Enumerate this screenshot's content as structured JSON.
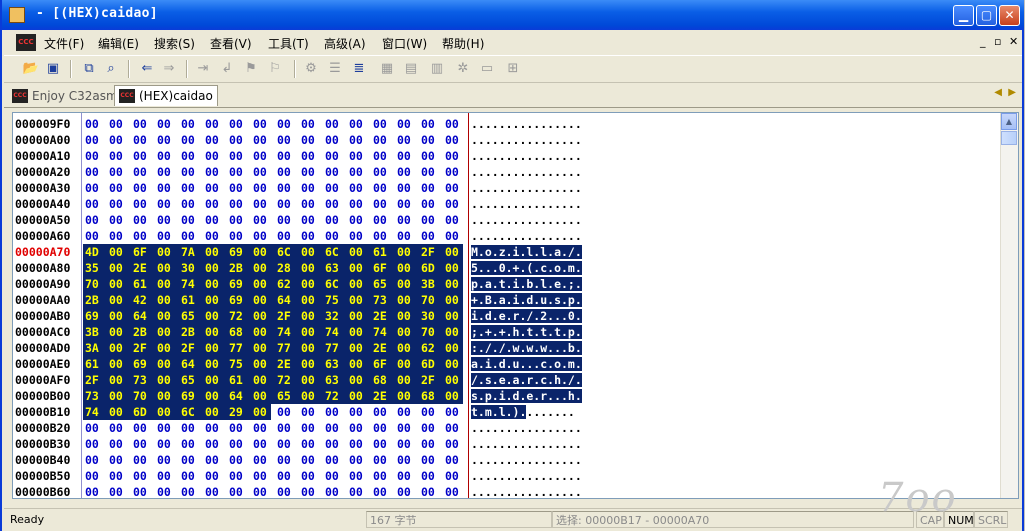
{
  "window": {
    "title": "- [(HEX)caidao]"
  },
  "menu": [
    "文件(F)",
    "编辑(E)",
    "搜索(S)",
    "查看(V)",
    "工具(T)",
    "高级(A)",
    "窗口(W)",
    "帮助(H)"
  ],
  "tabs": [
    {
      "label": "Enjoy C32asm",
      "active": false
    },
    {
      "label": "(HEX)caidao",
      "active": true
    }
  ],
  "hex": {
    "rows": [
      {
        "addr": "000009F0",
        "bytes": [
          "00",
          "00",
          "00",
          "00",
          "00",
          "00",
          "00",
          "00",
          "00",
          "00",
          "00",
          "00",
          "00",
          "00",
          "00",
          "00"
        ],
        "ascii": "................",
        "sel_from": -1,
        "sel_to": -1,
        "addr_highlight": false
      },
      {
        "addr": "00000A00",
        "bytes": [
          "00",
          "00",
          "00",
          "00",
          "00",
          "00",
          "00",
          "00",
          "00",
          "00",
          "00",
          "00",
          "00",
          "00",
          "00",
          "00"
        ],
        "ascii": "................",
        "sel_from": -1,
        "sel_to": -1,
        "addr_highlight": false
      },
      {
        "addr": "00000A10",
        "bytes": [
          "00",
          "00",
          "00",
          "00",
          "00",
          "00",
          "00",
          "00",
          "00",
          "00",
          "00",
          "00",
          "00",
          "00",
          "00",
          "00"
        ],
        "ascii": "................",
        "sel_from": -1,
        "sel_to": -1,
        "addr_highlight": false
      },
      {
        "addr": "00000A20",
        "bytes": [
          "00",
          "00",
          "00",
          "00",
          "00",
          "00",
          "00",
          "00",
          "00",
          "00",
          "00",
          "00",
          "00",
          "00",
          "00",
          "00"
        ],
        "ascii": "................",
        "sel_from": -1,
        "sel_to": -1,
        "addr_highlight": false
      },
      {
        "addr": "00000A30",
        "bytes": [
          "00",
          "00",
          "00",
          "00",
          "00",
          "00",
          "00",
          "00",
          "00",
          "00",
          "00",
          "00",
          "00",
          "00",
          "00",
          "00"
        ],
        "ascii": "................",
        "sel_from": -1,
        "sel_to": -1,
        "addr_highlight": false
      },
      {
        "addr": "00000A40",
        "bytes": [
          "00",
          "00",
          "00",
          "00",
          "00",
          "00",
          "00",
          "00",
          "00",
          "00",
          "00",
          "00",
          "00",
          "00",
          "00",
          "00"
        ],
        "ascii": "................",
        "sel_from": -1,
        "sel_to": -1,
        "addr_highlight": false
      },
      {
        "addr": "00000A50",
        "bytes": [
          "00",
          "00",
          "00",
          "00",
          "00",
          "00",
          "00",
          "00",
          "00",
          "00",
          "00",
          "00",
          "00",
          "00",
          "00",
          "00"
        ],
        "ascii": "................",
        "sel_from": -1,
        "sel_to": -1,
        "addr_highlight": false
      },
      {
        "addr": "00000A60",
        "bytes": [
          "00",
          "00",
          "00",
          "00",
          "00",
          "00",
          "00",
          "00",
          "00",
          "00",
          "00",
          "00",
          "00",
          "00",
          "00",
          "00"
        ],
        "ascii": "................",
        "sel_from": -1,
        "sel_to": -1,
        "addr_highlight": false
      },
      {
        "addr": "00000A70",
        "bytes": [
          "4D",
          "00",
          "6F",
          "00",
          "7A",
          "00",
          "69",
          "00",
          "6C",
          "00",
          "6C",
          "00",
          "61",
          "00",
          "2F",
          "00"
        ],
        "ascii": "M.o.z.i.l.l.a./.",
        "sel_from": 0,
        "sel_to": 15,
        "addr_highlight": true
      },
      {
        "addr": "00000A80",
        "bytes": [
          "35",
          "00",
          "2E",
          "00",
          "30",
          "00",
          "2B",
          "00",
          "28",
          "00",
          "63",
          "00",
          "6F",
          "00",
          "6D",
          "00"
        ],
        "ascii": "5...0.+.(.c.o.m.",
        "sel_from": 0,
        "sel_to": 15,
        "addr_highlight": false
      },
      {
        "addr": "00000A90",
        "bytes": [
          "70",
          "00",
          "61",
          "00",
          "74",
          "00",
          "69",
          "00",
          "62",
          "00",
          "6C",
          "00",
          "65",
          "00",
          "3B",
          "00"
        ],
        "ascii": "p.a.t.i.b.l.e.;.",
        "sel_from": 0,
        "sel_to": 15,
        "addr_highlight": false
      },
      {
        "addr": "00000AA0",
        "bytes": [
          "2B",
          "00",
          "42",
          "00",
          "61",
          "00",
          "69",
          "00",
          "64",
          "00",
          "75",
          "00",
          "73",
          "00",
          "70",
          "00"
        ],
        "ascii": "+.B.a.i.d.u.s.p.",
        "sel_from": 0,
        "sel_to": 15,
        "addr_highlight": false
      },
      {
        "addr": "00000AB0",
        "bytes": [
          "69",
          "00",
          "64",
          "00",
          "65",
          "00",
          "72",
          "00",
          "2F",
          "00",
          "32",
          "00",
          "2E",
          "00",
          "30",
          "00"
        ],
        "ascii": "i.d.e.r./.2...0.",
        "sel_from": 0,
        "sel_to": 15,
        "addr_highlight": false
      },
      {
        "addr": "00000AC0",
        "bytes": [
          "3B",
          "00",
          "2B",
          "00",
          "2B",
          "00",
          "68",
          "00",
          "74",
          "00",
          "74",
          "00",
          "74",
          "00",
          "70",
          "00"
        ],
        "ascii": ";.+.+.h.t.t.t.p.",
        "sel_from": 0,
        "sel_to": 15,
        "addr_highlight": false
      },
      {
        "addr": "00000AD0",
        "bytes": [
          "3A",
          "00",
          "2F",
          "00",
          "2F",
          "00",
          "77",
          "00",
          "77",
          "00",
          "77",
          "00",
          "2E",
          "00",
          "62",
          "00"
        ],
        "ascii": ":././.w.w.w...b.",
        "sel_from": 0,
        "sel_to": 15,
        "addr_highlight": false
      },
      {
        "addr": "00000AE0",
        "bytes": [
          "61",
          "00",
          "69",
          "00",
          "64",
          "00",
          "75",
          "00",
          "2E",
          "00",
          "63",
          "00",
          "6F",
          "00",
          "6D",
          "00"
        ],
        "ascii": "a.i.d.u...c.o.m.",
        "sel_from": 0,
        "sel_to": 15,
        "addr_highlight": false
      },
      {
        "addr": "00000AF0",
        "bytes": [
          "2F",
          "00",
          "73",
          "00",
          "65",
          "00",
          "61",
          "00",
          "72",
          "00",
          "63",
          "00",
          "68",
          "00",
          "2F",
          "00"
        ],
        "ascii": "/.s.e.a.r.c.h./.",
        "sel_from": 0,
        "sel_to": 15,
        "addr_highlight": false
      },
      {
        "addr": "00000B00",
        "bytes": [
          "73",
          "00",
          "70",
          "00",
          "69",
          "00",
          "64",
          "00",
          "65",
          "00",
          "72",
          "00",
          "2E",
          "00",
          "68",
          "00"
        ],
        "ascii": "s.p.i.d.e.r...h.",
        "sel_from": 0,
        "sel_to": 15,
        "addr_highlight": false
      },
      {
        "addr": "00000B10",
        "bytes": [
          "74",
          "00",
          "6D",
          "00",
          "6C",
          "00",
          "29",
          "00",
          "00",
          "00",
          "00",
          "00",
          "00",
          "00",
          "00",
          "00"
        ],
        "ascii": "t.m.l.)........",
        "sel_from": 0,
        "sel_to": 7,
        "addr_highlight": false
      },
      {
        "addr": "00000B20",
        "bytes": [
          "00",
          "00",
          "00",
          "00",
          "00",
          "00",
          "00",
          "00",
          "00",
          "00",
          "00",
          "00",
          "00",
          "00",
          "00",
          "00"
        ],
        "ascii": "................",
        "sel_from": -1,
        "sel_to": -1,
        "addr_highlight": false
      },
      {
        "addr": "00000B30",
        "bytes": [
          "00",
          "00",
          "00",
          "00",
          "00",
          "00",
          "00",
          "00",
          "00",
          "00",
          "00",
          "00",
          "00",
          "00",
          "00",
          "00"
        ],
        "ascii": "................",
        "sel_from": -1,
        "sel_to": -1,
        "addr_highlight": false
      },
      {
        "addr": "00000B40",
        "bytes": [
          "00",
          "00",
          "00",
          "00",
          "00",
          "00",
          "00",
          "00",
          "00",
          "00",
          "00",
          "00",
          "00",
          "00",
          "00",
          "00"
        ],
        "ascii": "................",
        "sel_from": -1,
        "sel_to": -1,
        "addr_highlight": false
      },
      {
        "addr": "00000B50",
        "bytes": [
          "00",
          "00",
          "00",
          "00",
          "00",
          "00",
          "00",
          "00",
          "00",
          "00",
          "00",
          "00",
          "00",
          "00",
          "00",
          "00"
        ],
        "ascii": "................",
        "sel_from": -1,
        "sel_to": -1,
        "addr_highlight": false
      },
      {
        "addr": "00000B60",
        "bytes": [
          "00",
          "00",
          "00",
          "00",
          "00",
          "00",
          "00",
          "00",
          "00",
          "00",
          "00",
          "00",
          "00",
          "00",
          "00",
          "00"
        ],
        "ascii": "................",
        "sel_from": -1,
        "sel_to": -1,
        "addr_highlight": false
      }
    ]
  },
  "status": {
    "ready": "Ready",
    "size": "167 字节",
    "selection": "选择: 00000B17 - 00000A70",
    "cap": "CAP",
    "num": "NUM",
    "scrl": "SCRL"
  },
  "watermark": "7oo",
  "colors": {
    "hex_byte": "#0000c8",
    "selection_bg": "#0a246a",
    "selection_fg": "#ffff00",
    "addr_highlight": "#e00000"
  }
}
